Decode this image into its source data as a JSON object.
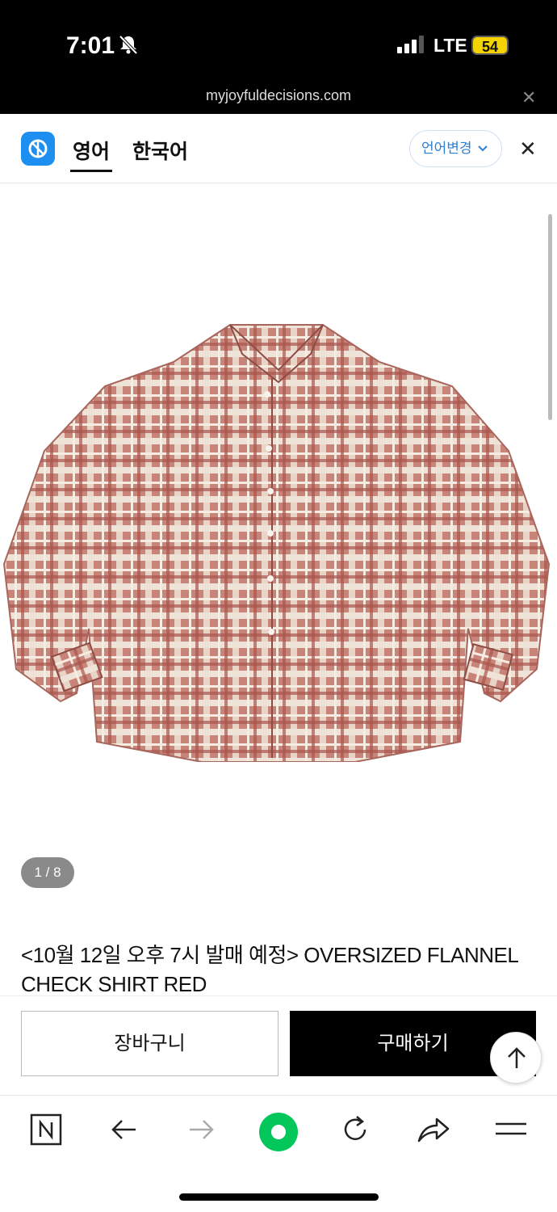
{
  "status": {
    "time": "7:01",
    "network": "LTE",
    "battery": "54"
  },
  "browser": {
    "url": "myjoyfuldecisions.com"
  },
  "translate_bar": {
    "tabs": [
      "영어",
      "한국어"
    ],
    "change_language": "언어변경"
  },
  "product": {
    "image_counter": "1 / 8",
    "title": "<10월 12일 오후 7시 발매 예정> OVERSIZED FLANNEL CHECK SHIRT RED"
  },
  "actions": {
    "cart": "장바구니",
    "buy": "구매하기"
  },
  "colors": {
    "accent_blue": "#1c8ff0",
    "naver_green": "#03c75a",
    "battery": "#f4d400"
  },
  "icons": [
    "bell-slash-icon",
    "signal-icon",
    "battery-icon",
    "close-icon",
    "translate-logo-icon",
    "chevron-down-icon",
    "arrow-up-icon",
    "naver-n-icon",
    "back-arrow-icon",
    "forward-arrow-icon",
    "green-dot-icon",
    "reload-icon",
    "share-icon",
    "menu-icon"
  ]
}
